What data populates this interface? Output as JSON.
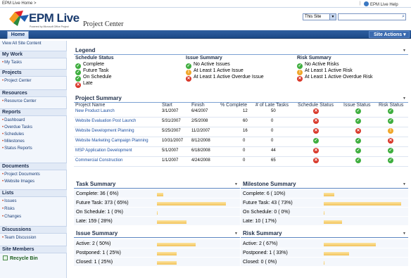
{
  "topbar": {
    "breadcrumb": "EPM Live Home >",
    "separator": "|",
    "right_link": "EPM Live Help"
  },
  "logo": {
    "text": "EPM Live",
    "sub": "Powered by Microsoft Office Project"
  },
  "page_title": "Project Center",
  "search": {
    "scope": "This Site",
    "placeholder": ""
  },
  "nav": {
    "home_tab": "Home",
    "site_actions": "Site Actions ▾"
  },
  "leftnav": {
    "view_all": "View All Site Content",
    "sections": [
      {
        "title": "My Work",
        "items": [
          "My Tasks"
        ]
      },
      {
        "title": "Projects",
        "items": [
          "Project Center"
        ]
      },
      {
        "title": "Resources",
        "items": [
          "Resource Center"
        ]
      },
      {
        "title": "Reports",
        "items": [
          "Dashboard",
          "Overdue Tasks",
          "Schedules",
          "Milestones",
          "Status Reports"
        ]
      },
      {
        "title": "Documents",
        "items": [
          "Project Documents",
          "Website Images"
        ]
      },
      {
        "title": "Lists",
        "items": [
          "Issues",
          "Risks",
          "Changes"
        ]
      },
      {
        "title": "Discussions",
        "items": [
          "Team Discussion"
        ]
      },
      {
        "title": "Site Members",
        "items": []
      }
    ],
    "recycle": "Recycle Bin"
  },
  "legend": {
    "title": "Legend",
    "schedule": {
      "title": "Schedule Status",
      "items": [
        "Complete",
        "Future Task",
        "On Schedule",
        "Late"
      ]
    },
    "issue": {
      "title": "Issue Summary",
      "items": [
        "No Active Issues",
        "At Least 1 Active Issue",
        "At Least 1 Active Overdue Issue"
      ]
    },
    "risk": {
      "title": "Risk Summary",
      "items": [
        "No Active Risks",
        "At Least 1 Active Risk",
        "At Least 1 Active Overdue Risk"
      ]
    }
  },
  "project_summary": {
    "title": "Project Summary",
    "columns": [
      "Project Name",
      "Start",
      "Finish",
      "% Complete",
      "# of Late Tasks",
      "Schedule Status",
      "Issue Status",
      "Risk Status"
    ],
    "rows": [
      {
        "name": "New Product Launch",
        "start": "3/1/2007",
        "finish": "6/4/2007",
        "pct": "12",
        "late": "50",
        "schedule": "r",
        "issue": "g",
        "risk": "g"
      },
      {
        "name": "Website Evaluation Post Launch",
        "start": "5/31/2007",
        "finish": "2/5/2008",
        "pct": "60",
        "late": "0",
        "schedule": "r",
        "issue": "g",
        "risk": "g"
      },
      {
        "name": "Website Development Planning",
        "start": "5/25/2007",
        "finish": "11/2/2007",
        "pct": "16",
        "late": "0",
        "schedule": "r",
        "issue": "r",
        "risk": "y"
      },
      {
        "name": "Website Marketing Campaign Planning",
        "start": "10/31/2007",
        "finish": "8/12/2008",
        "pct": "0",
        "late": "0",
        "schedule": "g",
        "issue": "g",
        "risk": "r"
      },
      {
        "name": "MSP Application Development",
        "start": "5/1/2007",
        "finish": "6/18/2008",
        "pct": "0",
        "late": "44",
        "schedule": "r",
        "issue": "g",
        "risk": "g"
      },
      {
        "name": "Commercial Construction",
        "start": "1/1/2007",
        "finish": "4/24/2008",
        "pct": "0",
        "late": "65",
        "schedule": "r",
        "issue": "g",
        "risk": "g"
      }
    ]
  },
  "panels": {
    "task": {
      "title": "Task Summary",
      "rows": [
        {
          "label": "Complete: 36 ( 6%)",
          "fraction": 0.06
        },
        {
          "label": "Future Task: 373 ( 65%)",
          "fraction": 0.65
        },
        {
          "label": "On Schedule: 1 ( 0%)",
          "fraction": 0.0
        },
        {
          "label": "Late: 159 ( 28%)",
          "fraction": 0.28
        }
      ]
    },
    "milestone": {
      "title": "Milestone Summary",
      "rows": [
        {
          "label": "Complete: 6 ( 10%)",
          "fraction": 0.1
        },
        {
          "label": "Future Task: 43 ( 73%)",
          "fraction": 0.73
        },
        {
          "label": "On Schedule: 0 ( 0%)",
          "fraction": 0.0
        },
        {
          "label": "Late: 10 ( 17%)",
          "fraction": 0.17
        }
      ]
    },
    "issue": {
      "title": "Issue Summary",
      "rows": [
        {
          "label": "Active: 2 ( 50%)",
          "fraction": 0.5
        },
        {
          "label": "Postponed: 1 ( 25%)",
          "fraction": 0.25
        },
        {
          "label": "Closed: 1 ( 25%)",
          "fraction": 0.25
        }
      ]
    },
    "risk": {
      "title": "Risk Summary",
      "rows": [
        {
          "label": "Active: 2 ( 67%)",
          "fraction": 0.67
        },
        {
          "label": "Postponed: 1 ( 33%)",
          "fraction": 0.33
        },
        {
          "label": "Closed: 0 ( 0%)",
          "fraction": 0.0
        }
      ]
    }
  },
  "colors": {
    "green": "#3fae3f",
    "yellow": "#f0a72a",
    "red": "#d9382a",
    "nav": "#1c4a88"
  }
}
